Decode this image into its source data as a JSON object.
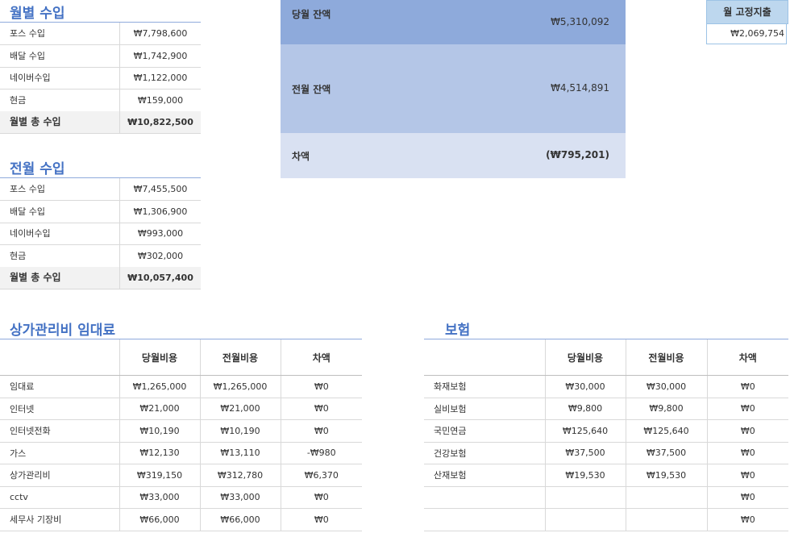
{
  "monthly_income": {
    "title": "월별 수입",
    "rows": [
      {
        "label": "포스 수입",
        "value": "₩7,798,600"
      },
      {
        "label": "배달 수입",
        "value": "₩1,742,900"
      },
      {
        "label": "네이버수입",
        "value": "₩1,122,000"
      },
      {
        "label": "현금",
        "value": "₩159,000"
      }
    ],
    "total_label": "월별 총 수입",
    "total_value": "₩10,822,500"
  },
  "prev_income": {
    "title": "전월 수입",
    "rows": [
      {
        "label": "포스 수입",
        "value": "₩7,455,500"
      },
      {
        "label": "배달 수입",
        "value": "₩1,306,900"
      },
      {
        "label": "네이버수입",
        "value": "₩993,000"
      },
      {
        "label": "현금",
        "value": "₩302,000"
      }
    ],
    "total_label": "월별 총 수입",
    "total_value": "₩10,057,400"
  },
  "balance": {
    "current_label": "당월 잔액",
    "current_value": "₩5,310,092",
    "prev_label": "전월 잔액",
    "prev_value": "₩4,514,891",
    "diff_label": "차액",
    "diff_value": "(₩795,201)"
  },
  "fixed": {
    "header": "월 고정지출",
    "value": "₩2,069,754"
  },
  "rent": {
    "title": "상가관리비 임대료",
    "headers": [
      "",
      "당월비용",
      "전월비용",
      "차액"
    ],
    "rows": [
      [
        "임대료",
        "₩1,265,000",
        "₩1,265,000",
        "₩0"
      ],
      [
        "인터넷",
        "₩21,000",
        "₩21,000",
        "₩0"
      ],
      [
        "인터넷전화",
        "₩10,190",
        "₩10,190",
        "₩0"
      ],
      [
        "가스",
        "₩12,130",
        "₩13,110",
        "-₩980"
      ],
      [
        "상가관리비",
        "₩319,150",
        "₩312,780",
        "₩6,370"
      ],
      [
        "cctv",
        "₩33,000",
        "₩33,000",
        "₩0"
      ],
      [
        "세무사 기장비",
        "₩66,000",
        "₩66,000",
        "₩0"
      ]
    ]
  },
  "insurance": {
    "title": "보험",
    "headers": [
      "",
      "당월비용",
      "전월비용",
      "차액"
    ],
    "rows": [
      [
        "화재보험",
        "₩30,000",
        "₩30,000",
        "₩0"
      ],
      [
        "실비보험",
        "₩9,800",
        "₩9,800",
        "₩0"
      ],
      [
        "국민연금",
        "₩125,640",
        "₩125,640",
        "₩0"
      ],
      [
        "건강보험",
        "₩37,500",
        "₩37,500",
        "₩0"
      ],
      [
        "산재보험",
        "₩19,530",
        "₩19,530",
        "₩0"
      ],
      [
        "",
        "",
        "",
        "₩0"
      ],
      [
        "",
        "",
        "",
        "₩0"
      ]
    ]
  },
  "colors": {
    "accent": "#4472c4",
    "balance_current": "#8eaadb",
    "balance_prev": "#b4c6e7",
    "balance_diff": "#d9e1f2",
    "negative": "#ff0000"
  }
}
